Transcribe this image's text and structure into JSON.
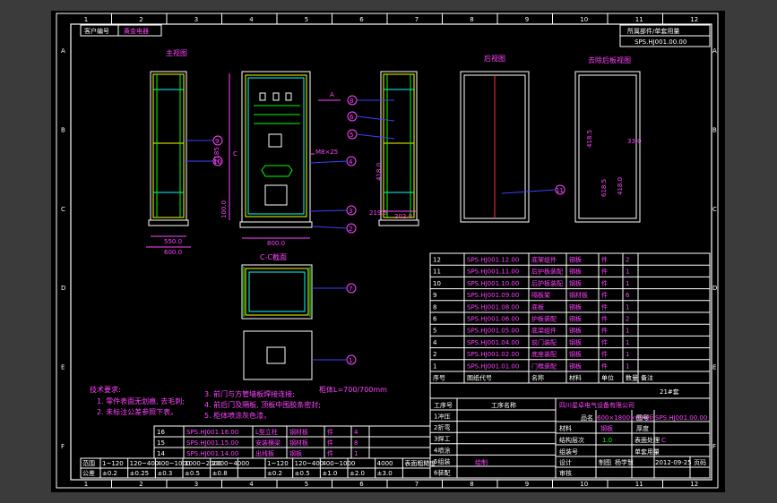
{
  "colors": {
    "background": "#000000",
    "frame": "#ffffff",
    "cabinet_outline": "#ffffff",
    "panel_yellow": "#ffff00",
    "panel_cyan": "#00ffff",
    "panel_green": "#00ff00",
    "text_magenta": "#ff44ff",
    "dim_magenta": "#ff44ff",
    "leader_blue": "#4040ff"
  },
  "header": {
    "customer_label": "客户编号",
    "customer_value": "黄金电器",
    "belongs_label": "所属部件/单套用量",
    "drawing_no": "SPS.HJ001.00.00"
  },
  "border": {
    "col_numbers": [
      "1",
      "2",
      "3",
      "4",
      "5",
      "6",
      "7",
      "8",
      "9",
      "10",
      "11",
      "12"
    ],
    "row_letters": [
      "A",
      "B",
      "C",
      "D",
      "E",
      "F"
    ]
  },
  "views": {
    "front_label": "主视图",
    "rear_label": "后视图",
    "rear_no_panel_label": "去除后板视图",
    "section_label": "C-C截面",
    "section_mark": "C",
    "arrow_mark": "A"
  },
  "dimensions": {
    "d550": "550.0",
    "d600": "600.0",
    "d800": "800.0",
    "d2185": "2185",
    "d100": "100.0",
    "d219": "219.5",
    "d202": "202.0",
    "d418": "418.0",
    "d618": "618.5",
    "d4185": "418.5",
    "d33": "33.0",
    "dM8": "M8×25"
  },
  "balloons": [
    "1",
    "2",
    "3",
    "4",
    "5",
    "6",
    "7",
    "8",
    "9",
    "10",
    "11"
  ],
  "bom": {
    "rows": [
      {
        "no": "12",
        "code": "SPS.HJ001.12.00",
        "name": "底架组件",
        "mat": "钢板",
        "unit": "件",
        "qty": "2",
        "note": ""
      },
      {
        "no": "11",
        "code": "SPS.HJ001.11.00",
        "name": "后护板装配",
        "mat": "钢板",
        "unit": "件",
        "qty": "1",
        "note": ""
      },
      {
        "no": "10",
        "code": "SPS.HJ001.10.00",
        "name": "后护板装配",
        "mat": "钢板",
        "unit": "件",
        "qty": "1",
        "note": ""
      },
      {
        "no": "9",
        "code": "SPS.HJ001.09.00",
        "name": "隔板架",
        "mat": "钢材板",
        "unit": "件",
        "qty": "6",
        "note": ""
      },
      {
        "no": "8",
        "code": "SPS.HJ001.08.00",
        "name": "底板",
        "mat": "钢板",
        "unit": "件",
        "qty": "1",
        "note": ""
      },
      {
        "no": "6",
        "code": "SPS.HJ001.06.00",
        "name": "护板装配",
        "mat": "钢板",
        "unit": "件",
        "qty": "2",
        "note": ""
      },
      {
        "no": "5",
        "code": "SPS.HJ001.05.00",
        "name": "底梁组件",
        "mat": "钢板",
        "unit": "件",
        "qty": "1",
        "note": ""
      },
      {
        "no": "4",
        "code": "SPS.HJ001.04.00",
        "name": "前门装配",
        "mat": "钢板",
        "unit": "件",
        "qty": "1",
        "note": ""
      },
      {
        "no": "2",
        "code": "SPS.HJ001.02.00",
        "name": "底座装配",
        "mat": "钢板",
        "unit": "件",
        "qty": "1",
        "note": ""
      },
      {
        "no": "1",
        "code": "SPS.HJ001.01.00",
        "name": "门框装配",
        "mat": "钢板",
        "unit": "件",
        "qty": "1",
        "note": ""
      }
    ],
    "headers": {
      "no": "序号",
      "code": "图纸代号",
      "name": "名称",
      "mat": "材料",
      "unit": "单位",
      "qty": "数量",
      "note": "备注"
    }
  },
  "bom2": {
    "rows": [
      {
        "no": "16",
        "code": "SPS.HJ001.16.00",
        "name": "L型立柱",
        "mat": "钢材板",
        "unit": "件",
        "qty": "4"
      },
      {
        "no": "15",
        "code": "SPS.HJ001.15.00",
        "name": "安装横梁",
        "mat": "钢材板",
        "unit": "件",
        "qty": "8"
      },
      {
        "no": "14",
        "code": "SPS.HJ001.14.00",
        "name": "出线板",
        "mat": "钢板",
        "unit": "件",
        "qty": "1"
      }
    ]
  },
  "tolerance": {
    "row1_label": "范围",
    "row1_vals": [
      "1~120",
      "120~400",
      "400~1000",
      "1000~2000",
      "2000~4000",
      "",
      "1~120",
      "120~400",
      "400~1000",
      "",
      "4000",
      "表面粗糙度"
    ],
    "row2_label": "公差",
    "row2_vals": [
      "±0.2",
      "±0.25",
      "±0.3",
      "±0.5",
      "±0.8",
      "",
      "±0.2",
      "±0.5",
      "±1.0",
      "±2.0",
      "±3.0",
      ""
    ]
  },
  "notes": {
    "title": "技术要求:",
    "items": [
      "1. 零件表面无划痕, 去毛刺;",
      "2. 未标注公差参照下表。",
      "3. 前门与方管墙板焊接连接;",
      "4. 前后门及隔板, 顶板中围胶条密封;",
      "5. 柜体喷涂灰色漆。"
    ],
    "extra": "柜体L=700/700mm"
  },
  "title_block": {
    "sheet_qty": "21#套",
    "proc_header": "工序号",
    "proc_name_header": "工序名称",
    "process": [
      "1冲压",
      "2折弯",
      "3焊工",
      "4喷涂",
      "5组装",
      "6装配"
    ],
    "company": "四川星卓电气设备有限公司",
    "part_label": "品名",
    "part_value": "600×1800×600柜",
    "draw_label": "图号",
    "draw_value": "SPS.HJ001.00.00",
    "material_label": "材料",
    "material_value": "钢板",
    "thickness_label": "厚度",
    "treatment_label": "结构层次",
    "treatment_value": "1.0",
    "surface_label": "表面处理",
    "surface_value": "C",
    "group_label": "组装号",
    "unit_qty_label": "单套用量",
    "design_label": "设计",
    "design_value": "绘制",
    "check_label": "审核",
    "draw_person_label": "制图",
    "draw_person_value": "杨学慧",
    "date": "2012-09-25",
    "page_label": "页码"
  }
}
